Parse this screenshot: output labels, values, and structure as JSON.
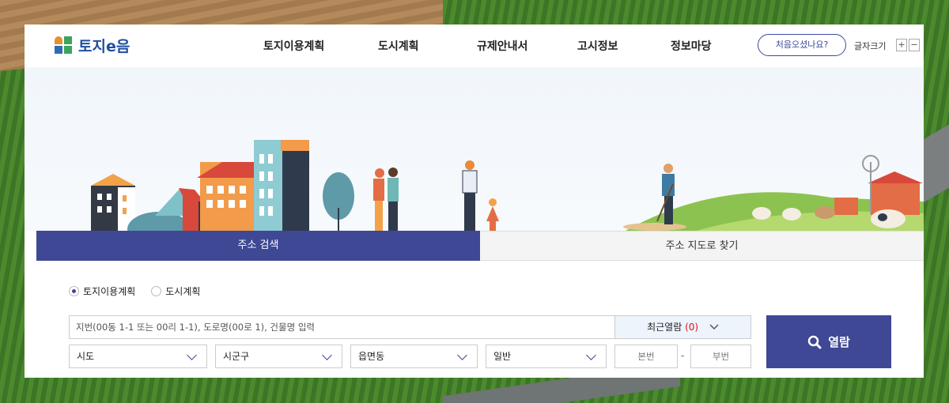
{
  "header": {
    "logo_text": "토지e음",
    "nav": [
      "토지이용계획",
      "도시계획",
      "규제안내서",
      "고시정보",
      "정보마당"
    ],
    "first_visit_button": "처음오셨나요?",
    "font_size_label": "글자크기",
    "font_plus": "+",
    "font_minus": "−"
  },
  "search": {
    "tabs": [
      "주소 검색",
      "주소 지도로 찾기"
    ],
    "radios": [
      {
        "label": "토지이용계획",
        "selected": true
      },
      {
        "label": "도시계획",
        "selected": false
      }
    ],
    "input_placeholder": "지번(00동 1-1 또는 00리 1-1), 도로명(00로 1), 건물명 입력",
    "recent_label": "최근열람",
    "recent_count": "(0)",
    "selects": {
      "sido": "시도",
      "sigungu": "시군구",
      "eupmyeondong": "읍면동",
      "type": "일반"
    },
    "main_number_placeholder": "본번",
    "dash": "-",
    "sub_number_placeholder": "부번",
    "view_button": "열람"
  },
  "colors": {
    "primary": "#3e4894",
    "accent_red": "#dd1122",
    "logo_blue": "#1f4fa0",
    "logo_green": "#3da35d"
  }
}
